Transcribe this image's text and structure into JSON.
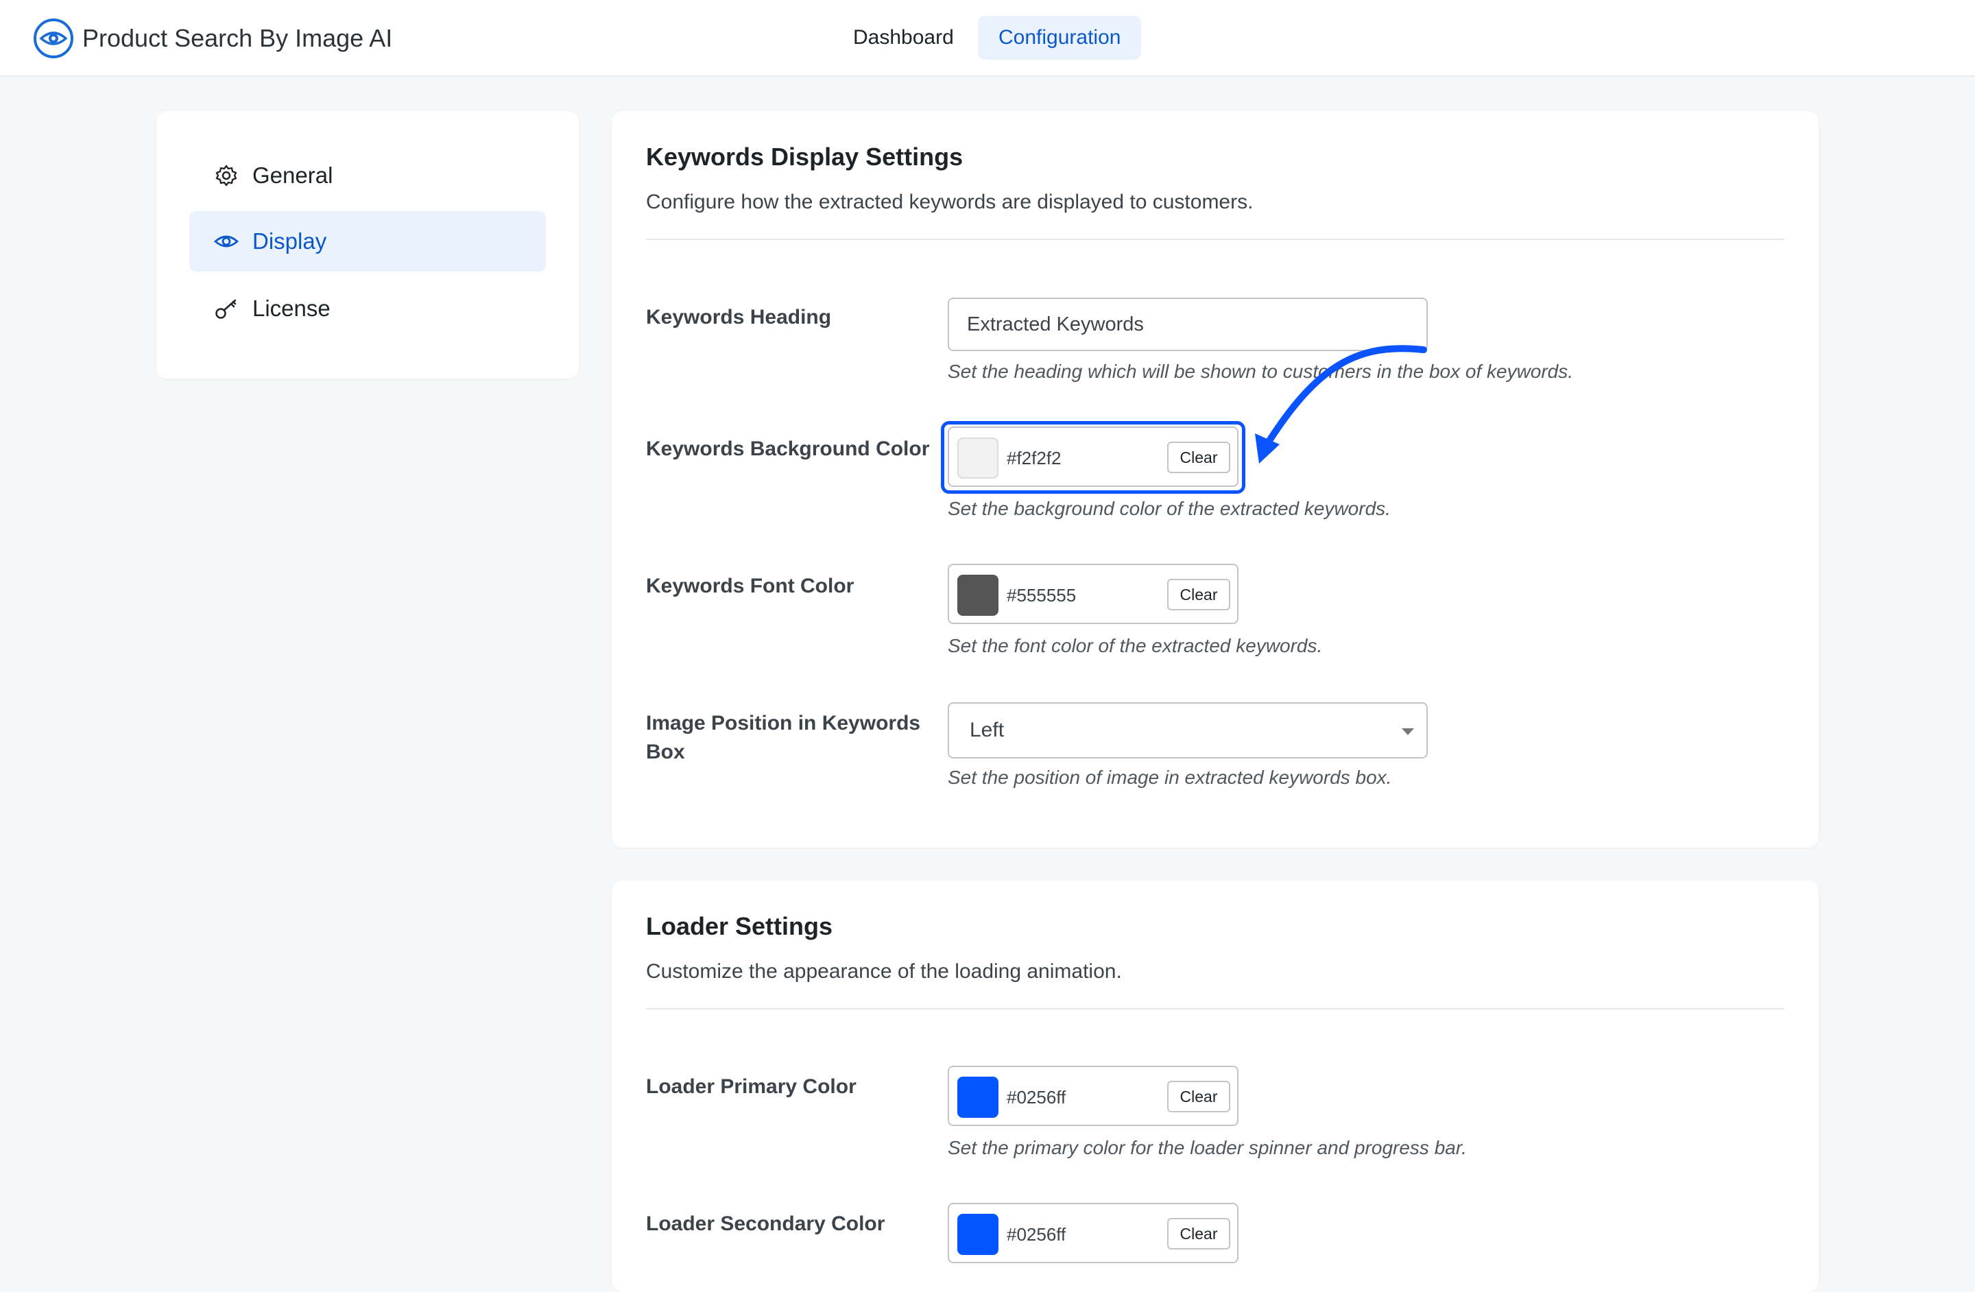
{
  "header": {
    "app_title": "Product Search By Image AI",
    "nav": [
      {
        "label": "Dashboard",
        "active": false
      },
      {
        "label": "Configuration",
        "active": true
      }
    ]
  },
  "sidebar": {
    "items": [
      {
        "label": "General",
        "icon": "gear-icon",
        "active": false
      },
      {
        "label": "Display",
        "icon": "eye-icon",
        "active": true
      },
      {
        "label": "License",
        "icon": "key-icon",
        "active": false
      }
    ]
  },
  "keywords_section": {
    "title": "Keywords Display Settings",
    "description": "Configure how the extracted keywords are displayed to customers.",
    "heading_field": {
      "label": "Keywords Heading",
      "value": "Extracted Keywords",
      "help": "Set the heading which will be shown to customers in the box of keywords."
    },
    "bg_color_field": {
      "label": "Keywords Background Color",
      "value": "#f2f2f2",
      "clear_label": "Clear",
      "help": "Set the background color of the extracted keywords."
    },
    "font_color_field": {
      "label": "Keywords Font Color",
      "value": "#555555",
      "clear_label": "Clear",
      "help": "Set the font color of the extracted keywords."
    },
    "image_position_field": {
      "label": "Image Position in Keywords Box",
      "selected": "Left",
      "help": "Set the position of image in extracted keywords box."
    }
  },
  "loader_section": {
    "title": "Loader Settings",
    "description": "Customize the appearance of the loading animation.",
    "primary_color_field": {
      "label": "Loader Primary Color",
      "value": "#0256ff",
      "clear_label": "Clear",
      "help": "Set the primary color for the loader spinner and progress bar."
    },
    "secondary_color_field": {
      "label": "Loader Secondary Color",
      "value": "#0256ff",
      "clear_label": "Clear"
    }
  },
  "colors": {
    "accent": "#0a58ca",
    "highlight": "#0a54ff",
    "active_bg": "#eaf2fe"
  }
}
